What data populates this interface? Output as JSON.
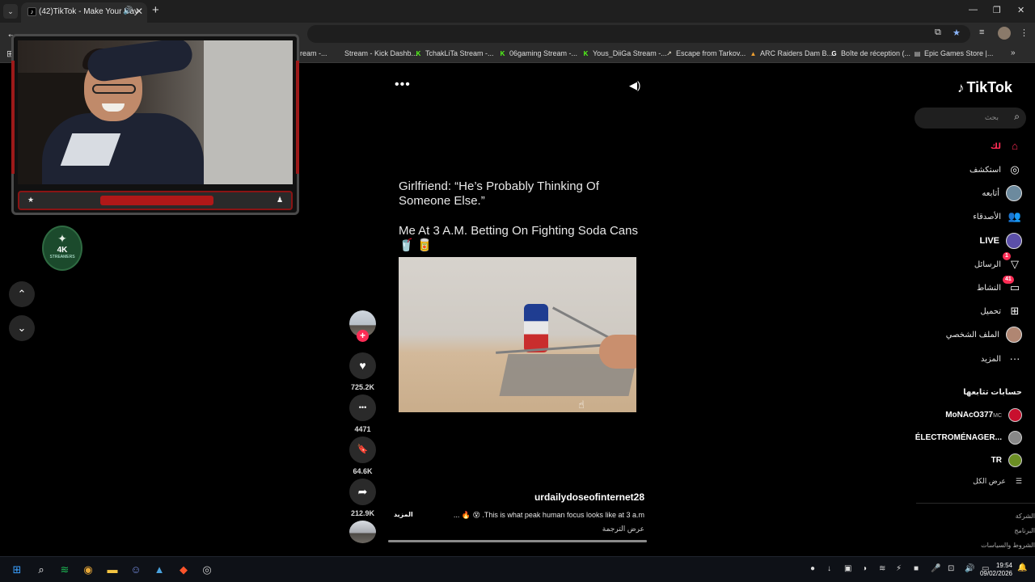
{
  "browser": {
    "tab_title": "(42)TikTok - Make Your Day",
    "tab_list_glyph": "⌄",
    "new_tab_glyph": "+",
    "close_glyph": "✕",
    "audio_glyph": "🔊",
    "window_controls": {
      "minimize": "—",
      "restore": "❐",
      "close": "✕"
    },
    "back_glyph": "←"
  },
  "bookmarks": [
    {
      "label": "ream -...",
      "icon": "purple-icon",
      "color": "#9146ff",
      "glyph": ""
    },
    {
      "label": "Stream - Kick Dashb...",
      "icon": "kick-icon",
      "color": "#53fc18",
      "glyph": ""
    },
    {
      "label": "TchakLiTa Stream -...",
      "icon": "kick-icon",
      "color": "#53fc18",
      "glyph": "K"
    },
    {
      "label": "06gaming Stream -...",
      "icon": "kick-icon",
      "color": "#53fc18",
      "glyph": "K"
    },
    {
      "label": "Yous_DiiGa Stream -...",
      "icon": "kick-icon",
      "color": "#53fc18",
      "glyph": "K"
    },
    {
      "label": "Escape from Tarkov...",
      "icon": "tarkov-icon",
      "color": "#cfc9b8",
      "glyph": "↗"
    },
    {
      "label": "ARC Raiders Dam B...",
      "icon": "arc-icon",
      "color": "#f0a030",
      "glyph": "▲"
    },
    {
      "label": "Boîte de réception (...",
      "icon": "google-icon",
      "color": "#ffffff",
      "glyph": "G"
    },
    {
      "label": "Epic Games Store |...",
      "icon": "epic-icon",
      "color": "#cccccc",
      "glyph": "▤"
    }
  ],
  "overlay": {
    "logo_mark": "✦",
    "logo_text": "4K",
    "logo_sub": "STREAMERS",
    "nav_up": "⌃",
    "nav_down": "⌄"
  },
  "video": {
    "menu_glyph": "•••",
    "audio_glyph": "◀)",
    "caption_line1": "Girlfriend: “He’s Probably Thinking Of Someone Else.”",
    "caption_line2": "Me At 3 A.M. Betting On Fighting Soda Cans 🥤 🥫",
    "author": "urdailydoseofinternet28",
    "description": "... 🔥 😵 .This is what peak human focus looks like at 3 a.m",
    "more_label": "المزيد",
    "translate_label": "عرض الترجمة",
    "progress": 1.0,
    "follow_glyph": "+",
    "actions": {
      "like": {
        "glyph": "♥",
        "count": "725.2K"
      },
      "comment": {
        "glyph": "•••",
        "count": "4471"
      },
      "save": {
        "glyph": "🔖",
        "count": "64.6K"
      },
      "share": {
        "glyph": "➦",
        "count": "212.9K"
      }
    }
  },
  "sidebar": {
    "logo": "TikTok",
    "logo_glyph": "♪",
    "search_placeholder": "بحث",
    "search_glyph": "⌕",
    "items": [
      {
        "label": "لك",
        "icon": "home-icon",
        "glyph": "⌂",
        "active": true
      },
      {
        "label": "استكشف",
        "icon": "compass-icon",
        "glyph": "◎"
      },
      {
        "label": "أتابعه",
        "icon": "following-avatar-icon",
        "glyph": ""
      },
      {
        "label": "الأصدقاء",
        "icon": "friends-icon",
        "glyph": "👥"
      },
      {
        "label": "LIVE",
        "icon": "live-avatar-icon",
        "glyph": ""
      },
      {
        "label": "الرسائل",
        "icon": "messages-icon",
        "glyph": "▽",
        "badge": "1"
      },
      {
        "label": "النشاط",
        "icon": "activity-icon",
        "glyph": "▭",
        "badge": "41"
      },
      {
        "label": "تحميل",
        "icon": "upload-icon",
        "glyph": "⊞"
      },
      {
        "label": "الملف الشخصي",
        "icon": "profile-avatar-icon",
        "glyph": ""
      },
      {
        "label": "المزيد",
        "icon": "more-icon",
        "glyph": "···"
      }
    ],
    "following_heading": "حسابات تتابعها",
    "accounts": [
      {
        "name": "MoNAcO377",
        "suffix": "MC",
        "color": "#c8102e"
      },
      {
        "name": "ÉLECTROMÉNAGER...",
        "suffix": "",
        "color": "#888888"
      },
      {
        "name": "TR",
        "suffix": "",
        "color": "#6b8e23"
      }
    ],
    "see_all": "عرض الكل",
    "see_all_glyph": "☰",
    "footer_links": [
      "الشركة",
      "البرنامج",
      "الشروط والسياسات"
    ]
  },
  "taskbar": {
    "apps": [
      {
        "name": "start-icon",
        "glyph": "⊞",
        "color": "#3aa0ff"
      },
      {
        "name": "search-icon",
        "glyph": "⌕",
        "color": "#ffffff"
      },
      {
        "name": "spotify-icon",
        "glyph": "≋",
        "color": "#1db954"
      },
      {
        "name": "chrome-icon",
        "glyph": "◉",
        "color": "#e8a838"
      },
      {
        "name": "file-explorer-icon",
        "glyph": "▬",
        "color": "#f4c542"
      },
      {
        "name": "discord-icon",
        "glyph": "☺",
        "color": "#7289da"
      },
      {
        "name": "photos-icon",
        "glyph": "▲",
        "color": "#4aa3df"
      },
      {
        "name": "brave-icon",
        "glyph": "◆",
        "color": "#fb542b"
      },
      {
        "name": "obs-icon",
        "glyph": "◎",
        "color": "#cccccc"
      }
    ],
    "tray": [
      "●",
      "↓",
      "▣",
      "◑",
      "≋",
      "⚡",
      "■",
      "🎤",
      "⊡",
      "🔊",
      "▭"
    ],
    "time": "19:54",
    "date": "09/02/2026",
    "notif_glyph": "🔔"
  }
}
